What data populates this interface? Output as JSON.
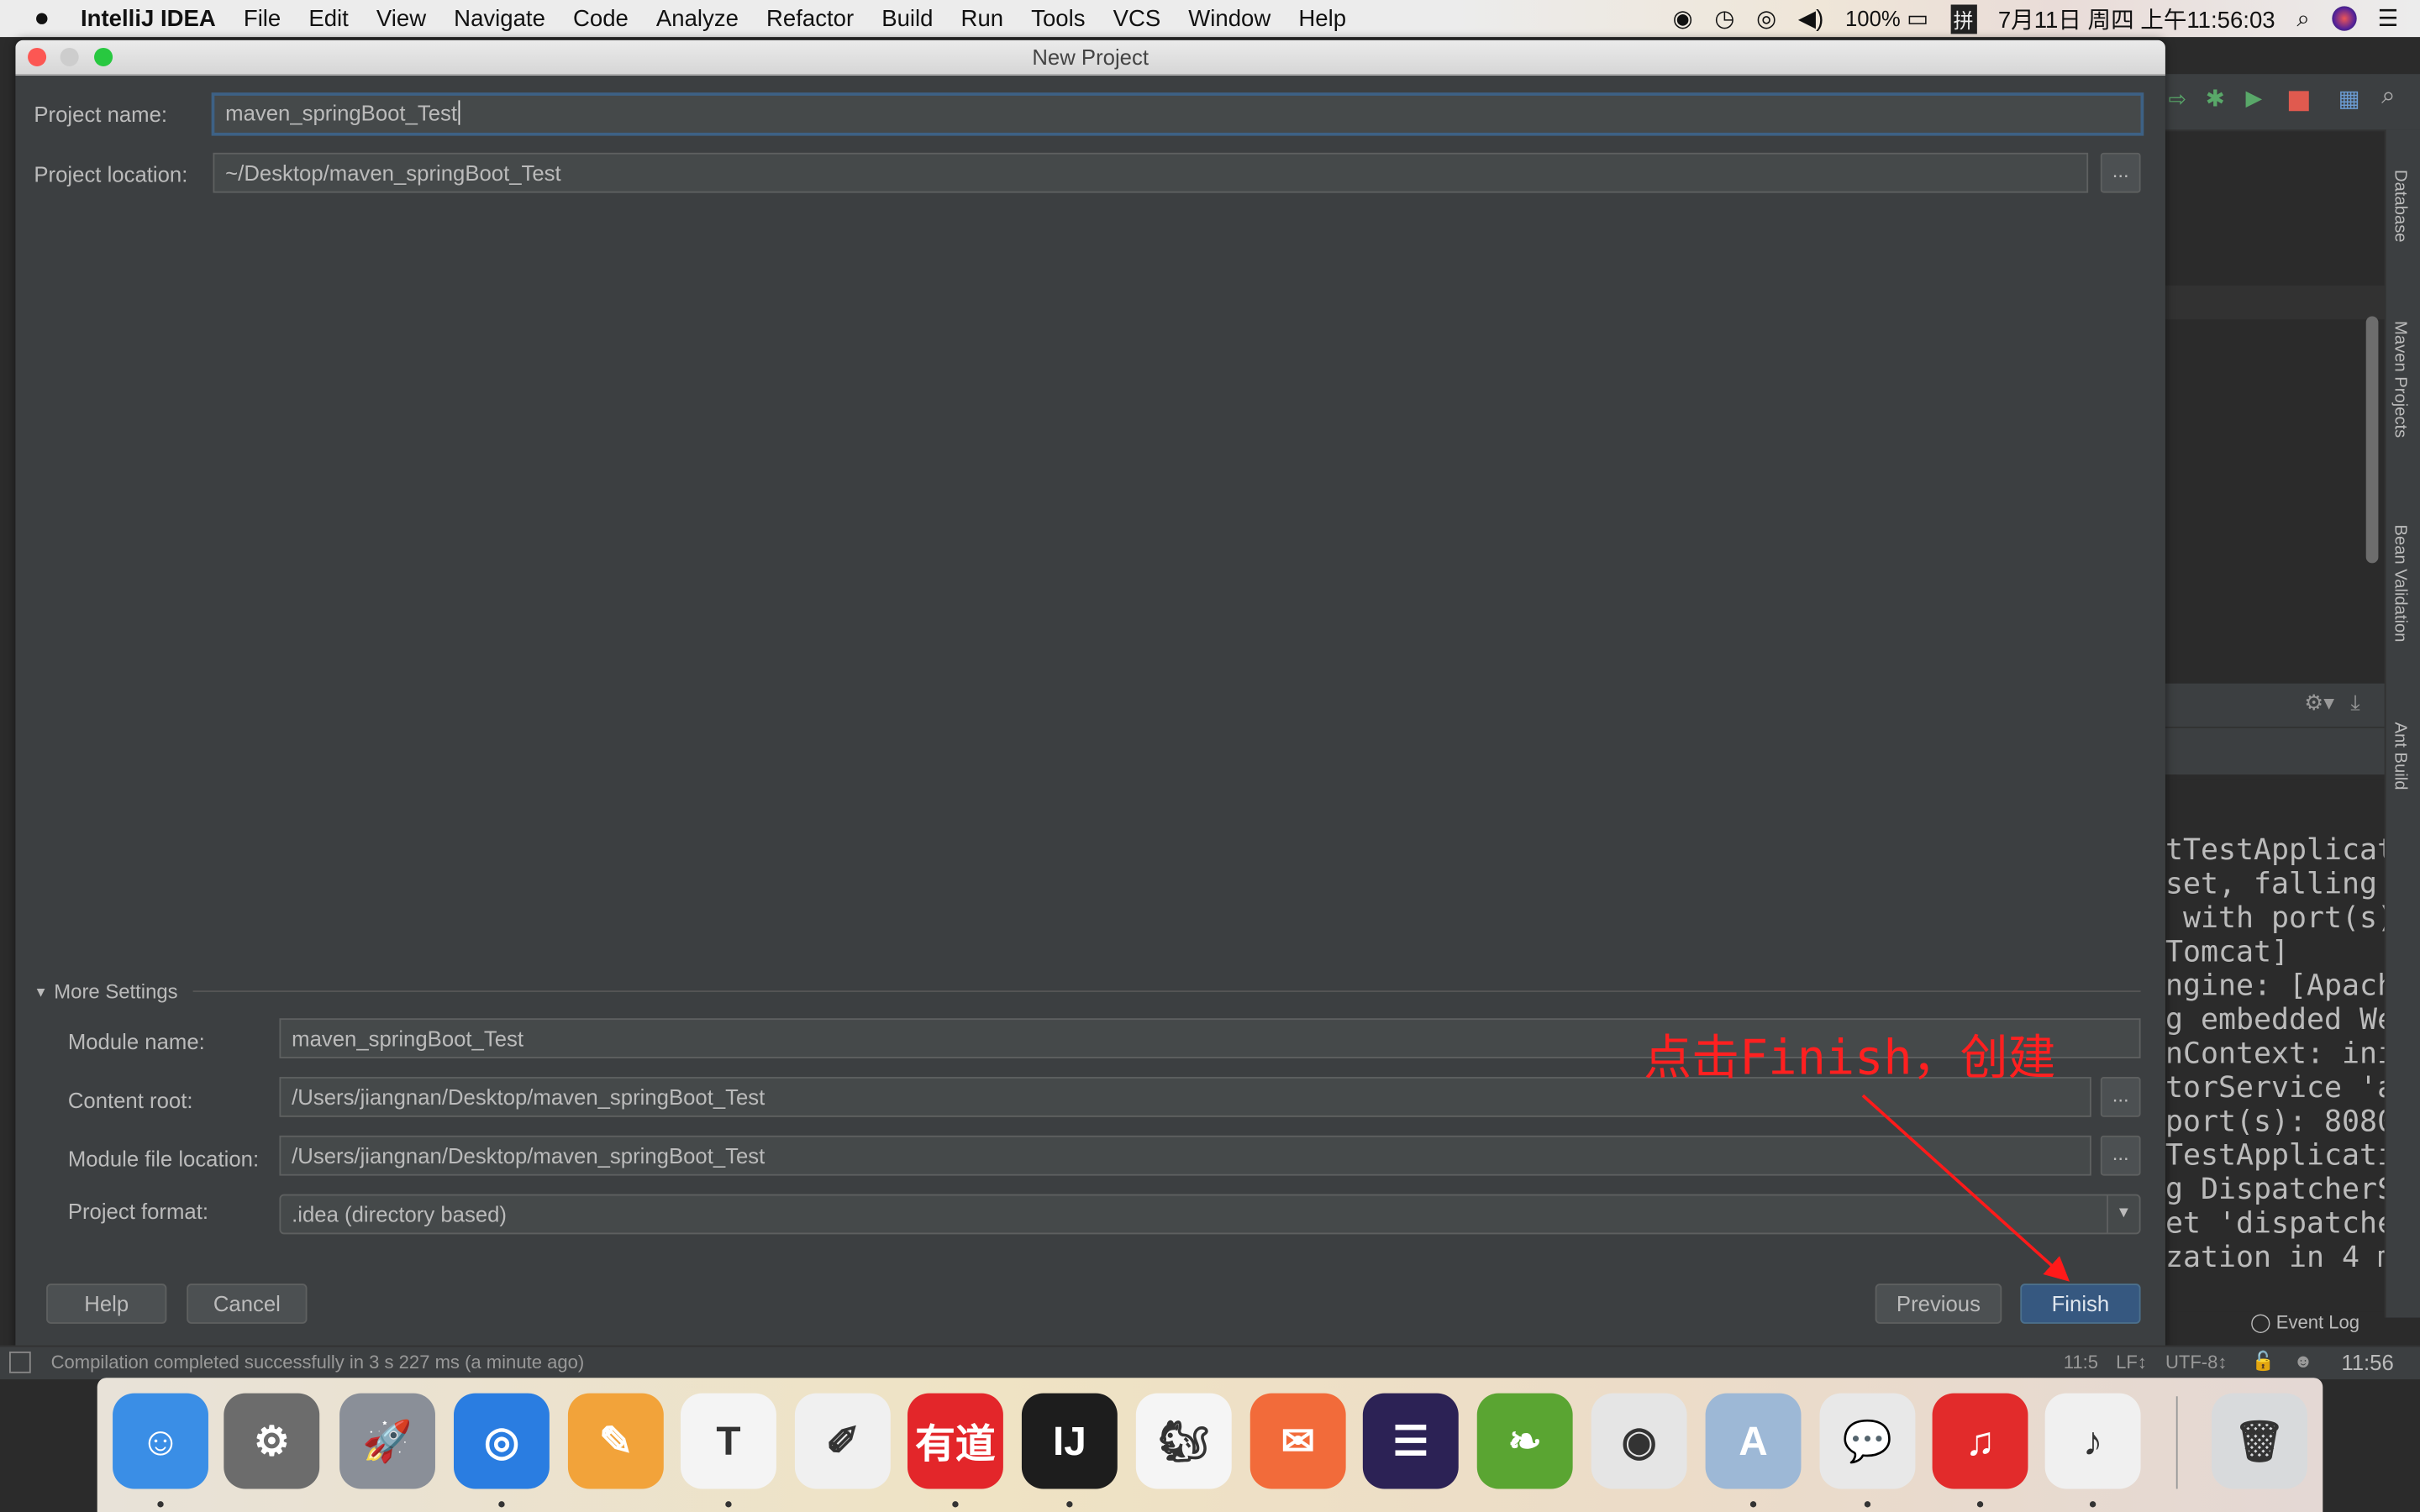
{
  "menubar": {
    "app_name": "IntelliJ IDEA",
    "items": [
      "File",
      "Edit",
      "View",
      "Navigate",
      "Code",
      "Analyze",
      "Refactor",
      "Build",
      "Run",
      "Tools",
      "VCS",
      "Window",
      "Help"
    ],
    "battery": "100%",
    "input_method": "拼",
    "clock": "7月11日 周四 上午11:56:03",
    "tray_icons": [
      "wechat-icon",
      "time-machine-icon",
      "cloud-icon",
      "volume-icon",
      "battery-icon",
      "input-method-icon",
      "search-icon",
      "siri-icon",
      "list-icon"
    ]
  },
  "dialog": {
    "title": "New Project",
    "project_name_label": "Project name:",
    "project_name_value": "maven_springBoot_Test",
    "project_location_label": "Project location:",
    "project_location_value": "~/Desktop/maven_springBoot_Test",
    "browse_label": "...",
    "more_settings_label": "More Settings",
    "module_name_label": "Module name:",
    "module_name_value": "maven_springBoot_Test",
    "content_root_label": "Content root:",
    "content_root_value": "/Users/jiangnan/Desktop/maven_springBoot_Test",
    "module_file_label": "Module file location:",
    "module_file_value": "/Users/jiangnan/Desktop/maven_springBoot_Test",
    "project_format_label": "Project format:",
    "project_format_value": ".idea (directory based)",
    "buttons": {
      "help": "Help",
      "cancel": "Cancel",
      "previous": "Previous",
      "finish": "Finish"
    }
  },
  "annotation": "点击Finish，创建",
  "ide": {
    "side_tabs": [
      "Database",
      "Maven Projects",
      "Bean Validation",
      "Ant Build"
    ],
    "console_lines": [
      "tTestApplicat",
      "set, falling",
      " with port(s)",
      "Tomcat]",
      "ngine: [Apach",
      "g embedded We",
      "nContext: ini",
      "torService 'a",
      "port(s): 8080",
      "TestApplicati",
      "g DispatcherS",
      "et 'dispatche",
      "zation in 4 m"
    ],
    "event_log": "Event Log"
  },
  "statusbar": {
    "message": "Compilation completed successfully in 3 s 227 ms (a minute ago)",
    "position": "11:5",
    "line_sep": "LF↕",
    "encoding": "UTF-8↕",
    "time": "11:56"
  },
  "dock": {
    "apps": [
      {
        "name": "Finder",
        "glyph": "☺",
        "color": "#3a8ee6"
      },
      {
        "name": "System Preferences",
        "glyph": "⚙",
        "color": "#6c6c6c"
      },
      {
        "name": "Launchpad",
        "glyph": "🚀",
        "color": "#8a8f98"
      },
      {
        "name": "Safari",
        "glyph": "◎",
        "color": "#2a7de1"
      },
      {
        "name": "Pages",
        "glyph": "✎",
        "color": "#f2a33a"
      },
      {
        "name": "Typora",
        "glyph": "T",
        "color": "#f4f4f4"
      },
      {
        "name": "TextEdit",
        "glyph": "✐",
        "color": "#f0f0f0"
      },
      {
        "name": "Youdao Dictionary",
        "glyph": "有道",
        "color": "#e3262a"
      },
      {
        "name": "IntelliJ IDEA",
        "glyph": "IJ",
        "color": "#1d1d1d"
      },
      {
        "name": "Sequel Pro",
        "glyph": "🐿",
        "color": "#f5f5f5"
      },
      {
        "name": "Postman",
        "glyph": "✉",
        "color": "#f26b3a"
      },
      {
        "name": "Eclipse",
        "glyph": "☰",
        "color": "#2c2255"
      },
      {
        "name": "Coda",
        "glyph": "❧",
        "color": "#5aa532"
      },
      {
        "name": "Google Chrome",
        "glyph": "◉",
        "color": "#e5e5e5"
      },
      {
        "name": "Xcode",
        "glyph": "A",
        "color": "#9db8d6"
      },
      {
        "name": "WeChat",
        "glyph": "💬",
        "color": "#e8e8e8"
      },
      {
        "name": "NetEase Music",
        "glyph": "♫",
        "color": "#e22b2b"
      },
      {
        "name": "iTunes",
        "glyph": "♪",
        "color": "#f0f0f0"
      },
      {
        "name": "Trash",
        "glyph": "🗑",
        "color": "#d8dadc"
      }
    ]
  },
  "colors": {
    "dialog_bg": "#3c3f41",
    "focus_border": "#3d6185",
    "primary_button": "#365880",
    "annotation": "#ff2020"
  }
}
